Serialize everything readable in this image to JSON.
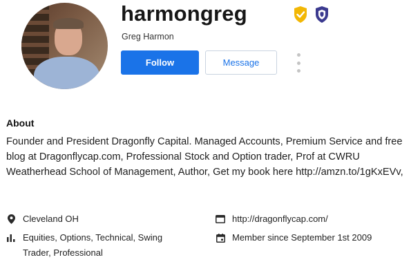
{
  "profile": {
    "username": "harmongreg",
    "full_name": "Greg Harmon",
    "badges": [
      "gold-shield-check-icon",
      "purple-shield-icon"
    ]
  },
  "actions": {
    "follow_label": "Follow",
    "message_label": "Message"
  },
  "about": {
    "title": "About",
    "text": "Founder and President Dragonfly Capital. Managed Accounts, Premium Service and free blog at Dragonflycap.com, Professional Stock and Option trader, Prof at CWRU Weatherhead School of Management, Author, Get my book here http://amzn.to/1gKxEVv,"
  },
  "details": {
    "location": "Cleveland OH",
    "trading_style": "Equities, Options, Technical, Swing Trader, Professional",
    "website": "http://dragonflycap.com/",
    "member_since": "Member since September 1st 2009"
  },
  "colors": {
    "accent": "#1a73e8",
    "badge_gold": "#f2b705",
    "badge_purple": "#3b3a8f"
  }
}
